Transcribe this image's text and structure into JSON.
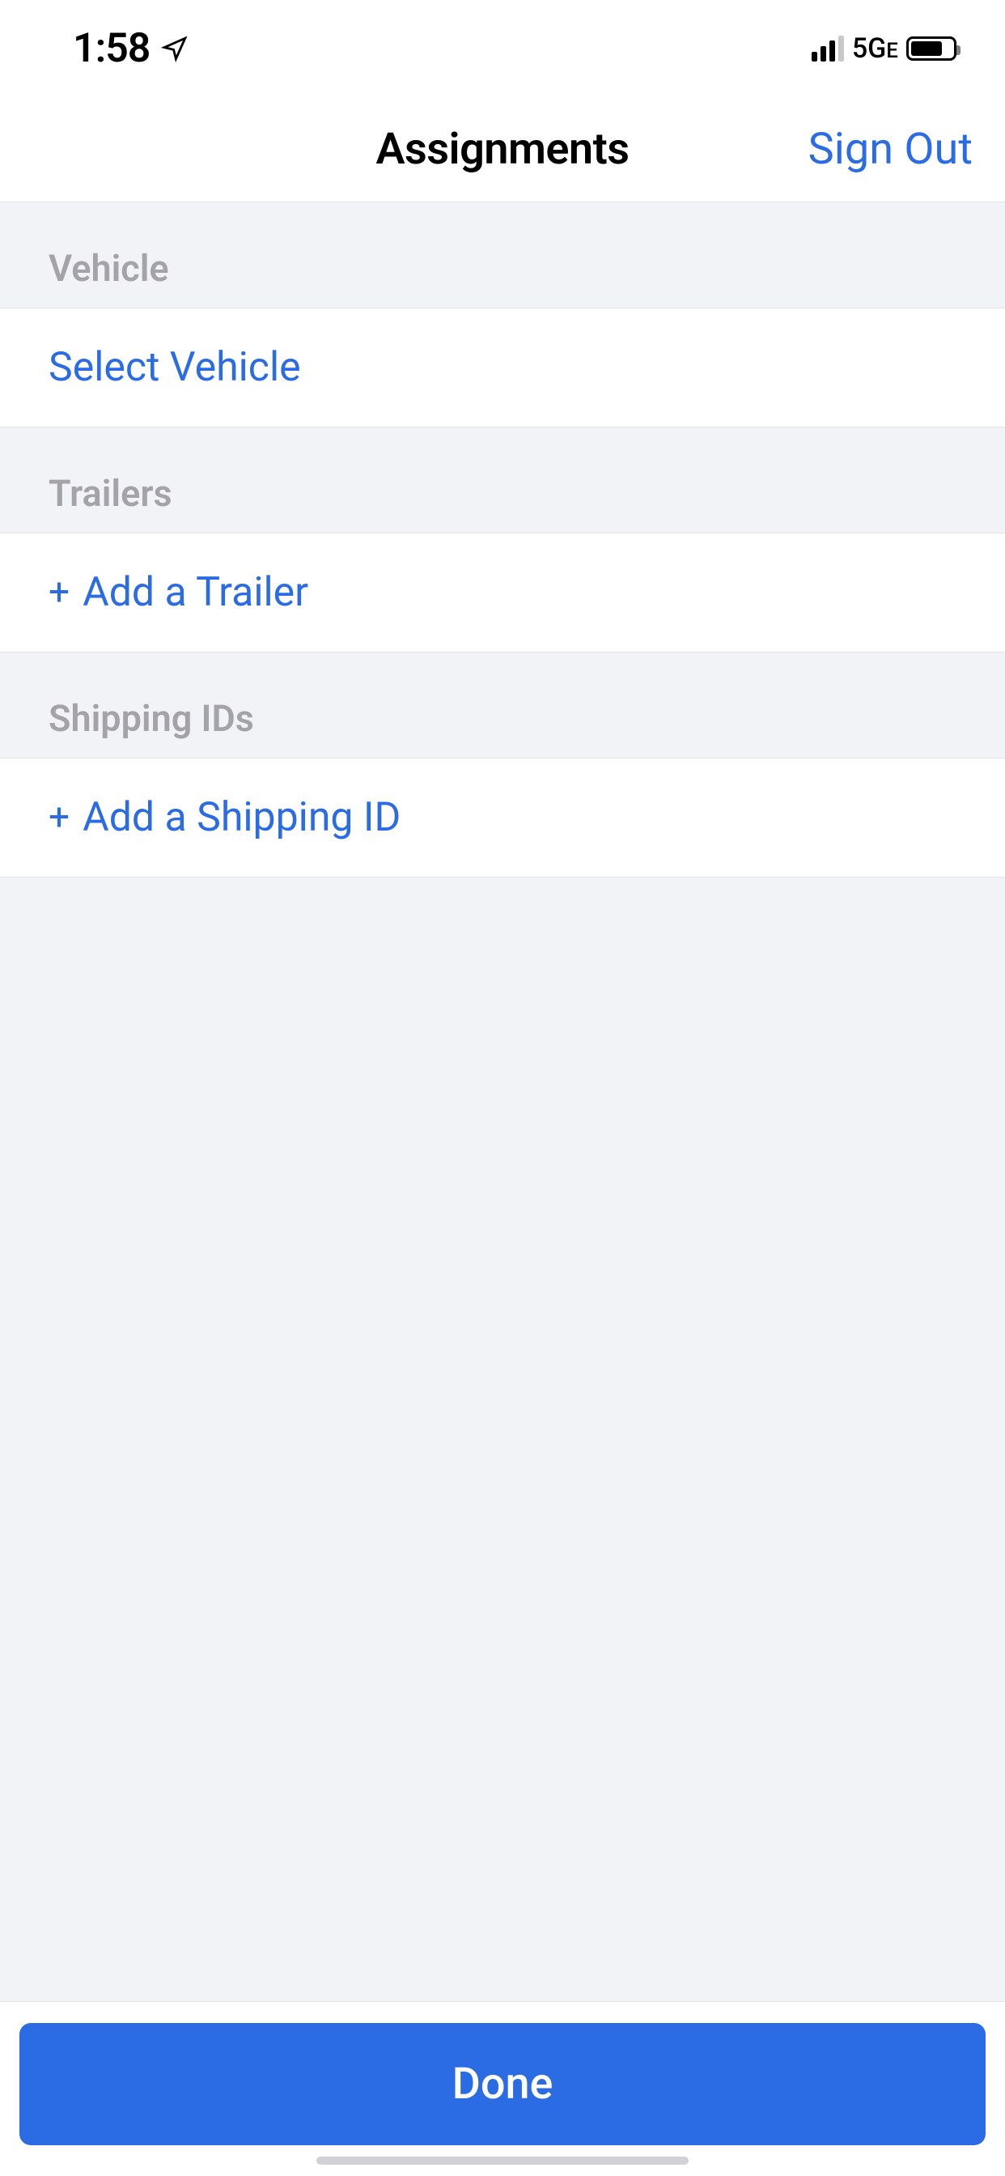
{
  "status": {
    "time": "1:58",
    "network": "5G",
    "network_suffix": "E"
  },
  "nav": {
    "title": "Assignments",
    "sign_out": "Sign Out"
  },
  "sections": {
    "vehicle": {
      "header": "Vehicle",
      "action": "Select Vehicle"
    },
    "trailers": {
      "header": "Trailers",
      "action": "Add a Trailer"
    },
    "shipping": {
      "header": "Shipping IDs",
      "action": "Add a Shipping ID"
    }
  },
  "footer": {
    "done": "Done"
  }
}
